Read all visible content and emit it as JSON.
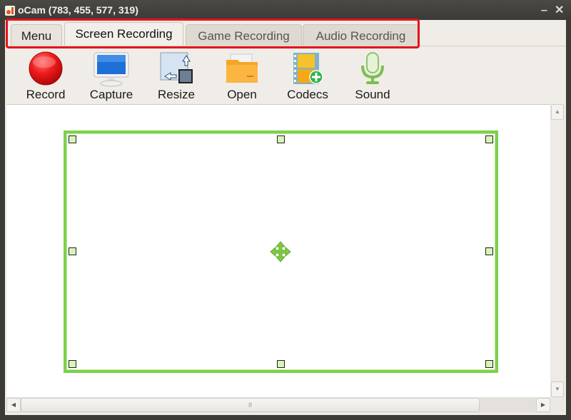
{
  "window": {
    "title": "oCam (783, 455, 577, 319)",
    "app_icon": "ocam-logo-icon",
    "minimize_icon": "minimize-icon",
    "close_icon": "close-icon"
  },
  "tabs": [
    {
      "label": "Menu",
      "active": false
    },
    {
      "label": "Screen Recording",
      "active": true
    },
    {
      "label": "Game Recording",
      "active": false
    },
    {
      "label": "Audio Recording",
      "active": false
    }
  ],
  "highlight_color": "#e8101a",
  "toolbar": {
    "items": [
      {
        "label": "Record",
        "icon": "record-icon"
      },
      {
        "label": "Capture",
        "icon": "monitor-icon"
      },
      {
        "label": "Resize",
        "icon": "resize-icon"
      },
      {
        "label": "Open",
        "icon": "folder-icon"
      },
      {
        "label": "Codecs",
        "icon": "film-add-icon"
      },
      {
        "label": "Sound",
        "icon": "microphone-icon"
      }
    ]
  },
  "capture_region": {
    "border_color": "#7dd14a",
    "handle_color": "#d7f5b8",
    "move_icon": "move-arrows-icon"
  },
  "scrollbars": {
    "up_glyph": "▲",
    "down_glyph": "▼",
    "left_glyph": "◀",
    "right_glyph": "▶",
    "grip_glyph": "II"
  }
}
